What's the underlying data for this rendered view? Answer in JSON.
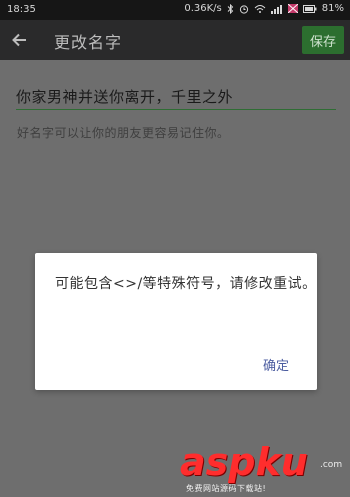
{
  "status_bar": {
    "time": "18:35",
    "network_speed": "0.36K/s",
    "battery": "81%"
  },
  "app_bar": {
    "title": "更改名字",
    "save_label": "保存"
  },
  "form": {
    "name_value": "你家男神并送你离开，千里之外",
    "hint": "好名字可以让你的朋友更容易记住你。"
  },
  "dialog": {
    "message": "可能包含<>/等特殊符号，请修改重试。",
    "ok_label": "确定"
  },
  "watermark": {
    "brand": "aspku",
    "domain": ".com",
    "tagline": "免费网站源码下载站!"
  },
  "colors": {
    "accent_green": "#2c6e2f",
    "dialog_button": "#4c5da0",
    "watermark_red": "#ff2d2d"
  }
}
